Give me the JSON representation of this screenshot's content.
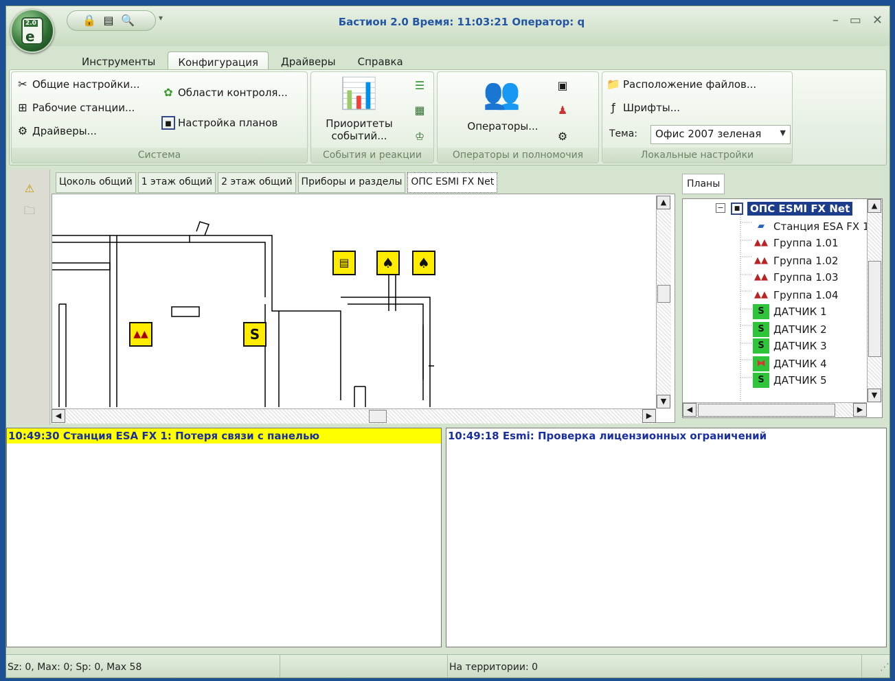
{
  "app": {
    "title": "Бастион 2.0 Время: 11:03:21 Оператор: q",
    "orb_badge": "2.0",
    "window_buttons": [
      "–",
      "▭",
      "✕"
    ]
  },
  "ribbon_tabs": [
    "Инструменты",
    "Конфигурация",
    "Драйверы",
    "Справка"
  ],
  "ribbon": {
    "system": {
      "label": "Система",
      "general": "Общие настройки...",
      "workstations": "Рабочие станции...",
      "drivers": "Драйверы...",
      "control_areas": "Области контроля...",
      "plan_setup": "Настройка планов"
    },
    "events": {
      "label": "События и реакции",
      "priorities_line1": "Приоритеты",
      "priorities_line2": "событий..."
    },
    "operators": {
      "label": "Операторы и полномочия",
      "operators": "Операторы..."
    },
    "local": {
      "label": "Локальные настройки",
      "files": "Расположение файлов...",
      "fonts": "Шрифты...",
      "theme_label": "Тема:",
      "theme_value": "Офис 2007 зеленая"
    }
  },
  "plan_tabs": [
    "Цоколь общий",
    "1 этаж общий",
    "2 этаж общий",
    "Приборы и разделы",
    "ОПС ESMI FX Net"
  ],
  "right_panel": {
    "tab": "Планы",
    "tree_root": "ОПС ESMI FX Net",
    "tree_items": [
      "Станция ESA FX 1",
      "Группа 1.01",
      "Группа 1.02",
      "Группа 1.03",
      "Группа 1.04",
      "ДАТЧИК 1",
      "ДАТЧИК 2",
      "ДАТЧИК 3",
      "ДАТЧИК 4",
      "ДАТЧИК 5"
    ]
  },
  "logs": {
    "left": "10:49:30 Станция ESA FX 1: Потеря связи с панелью",
    "right": "10:49:18 Esmi: Проверка лицензионных ограничений"
  },
  "status": {
    "left": "Sz: 0, Max: 0; Sp: 0, Max 58",
    "middle": "",
    "right": "На территории: 0"
  },
  "colors": {
    "alarm_highlight": "#ffff00",
    "log_text": "#1a2fa0",
    "tree_selection": "#1c3d8c",
    "plan_icon": "#ffec00"
  }
}
